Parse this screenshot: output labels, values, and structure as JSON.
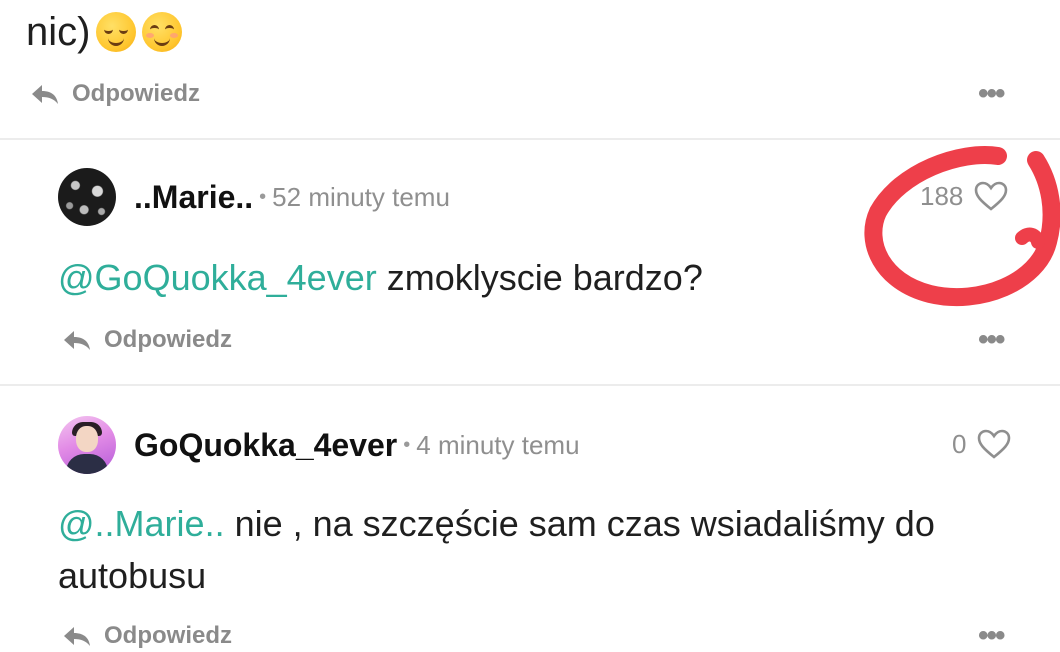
{
  "top_comment": {
    "text_fragment": "nic)",
    "emojis": [
      "relieved-face-emoji",
      "smiling-face-emoji"
    ],
    "reply_label": "Odpowiedz"
  },
  "comments": [
    {
      "author": "..Marie..",
      "time": "52 minuty temu",
      "likes": "188",
      "mention": "@GoQuokka_4ever",
      "text": " zmoklyscie bardzo?",
      "reply_label": "Odpowiedz"
    },
    {
      "author": "GoQuokka_4ever",
      "time": "4 minuty temu",
      "likes": "0",
      "mention": "@..Marie..",
      "text": " nie , na szczęście sam czas wsiadaliśmy do autobusu",
      "reply_label": "Odpowiedz"
    }
  ],
  "separator": "•",
  "more_label": "•••",
  "colors": {
    "mention": "#2fae9a",
    "muted": "#8f8f8f",
    "annotation": "#ee3f4a"
  },
  "icons": [
    "reply-arrow-icon",
    "more-options-icon",
    "heart-icon"
  ]
}
